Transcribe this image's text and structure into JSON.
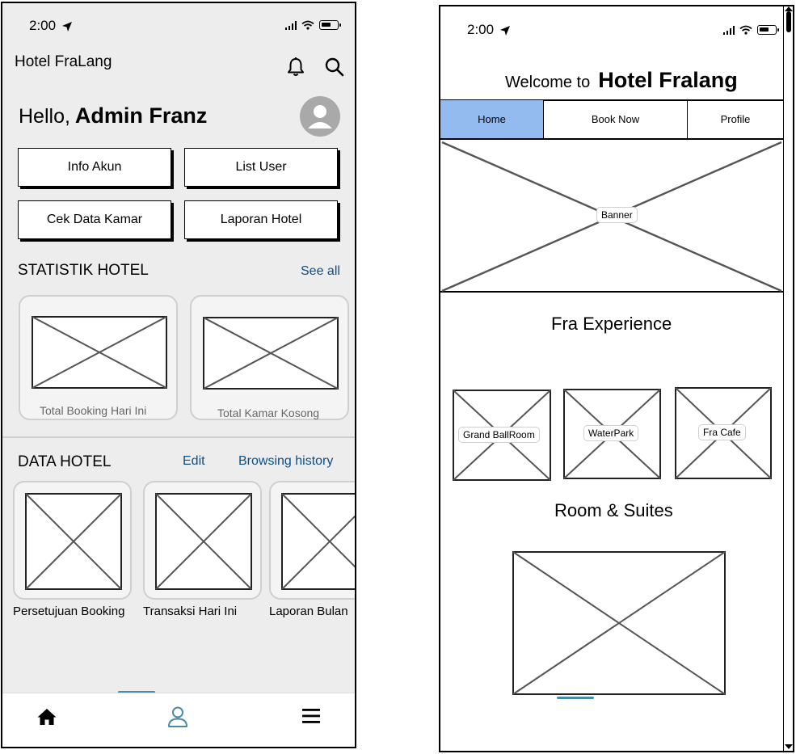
{
  "left": {
    "status": {
      "time": "2:00"
    },
    "app_title": "Hotel FraLang",
    "greeting": {
      "hello": "Hello,",
      "name": "Admin Franz"
    },
    "buttons": {
      "info_akun": "Info Akun",
      "list_user": "List User",
      "cek_data_kamar": "Cek Data Kamar",
      "laporan_hotel": "Laporan Hotel"
    },
    "statistik": {
      "title": "STATISTIK HOTEL",
      "see_all": "See all",
      "cards": [
        "Total Booking Hari Ini",
        "Total Kamar Kosong"
      ]
    },
    "data_hotel": {
      "title": "DATA HOTEL",
      "edit": "Edit",
      "history": "Browsing history",
      "cards": [
        "Persetujuan Booking",
        "Transaksi Hari Ini",
        "Laporan Bulan"
      ]
    },
    "tabbar": {
      "icons": [
        "home-icon",
        "user-icon",
        "menu-icon"
      ],
      "active_color": "#4a8bab"
    }
  },
  "right": {
    "status": {
      "time": "2:00"
    },
    "welcome": {
      "prefix": "Welcome to",
      "name": "Hotel Fralang"
    },
    "nav": {
      "items": [
        "Home",
        "Book Now",
        "Profile"
      ],
      "active_color": "#94bbf0"
    },
    "banner_label": "Banner",
    "experience": {
      "title": "Fra Experience",
      "items": [
        "Grand BallRoom",
        "WaterPark",
        "Fra Cafe"
      ]
    },
    "rooms": {
      "title": "Room & Suites"
    }
  }
}
